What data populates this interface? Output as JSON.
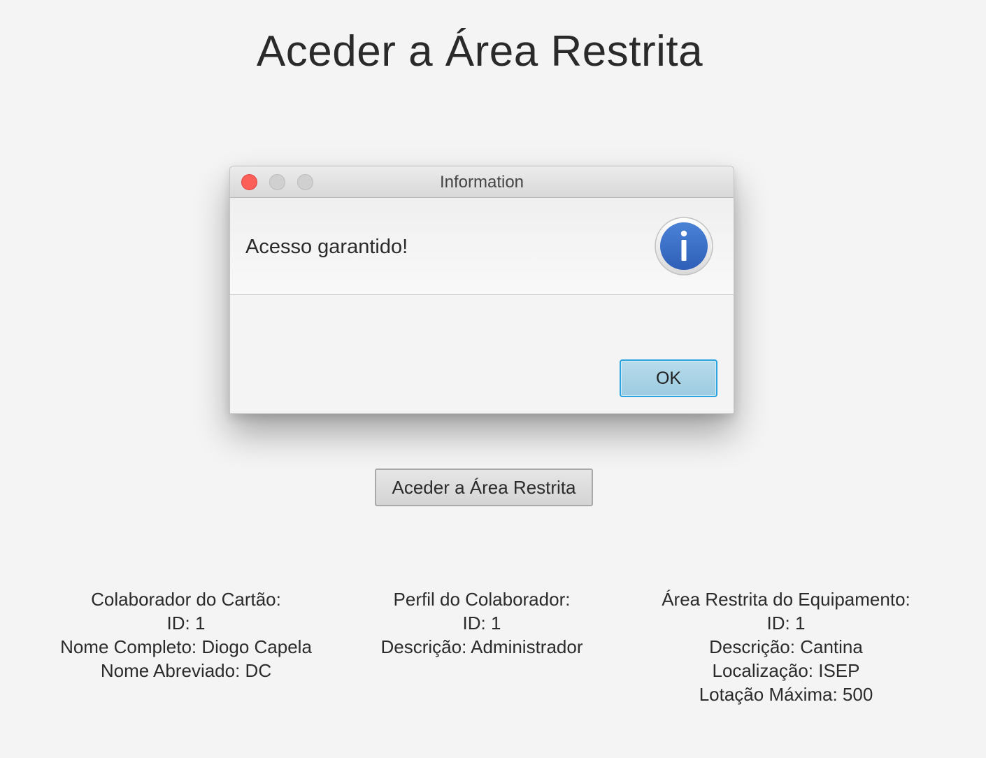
{
  "page": {
    "title": "Aceder a Área Restrita",
    "action_button": "Aceder a Área Restrita"
  },
  "dialog": {
    "title": "Information",
    "header_text": "Acesso garantido!",
    "icon": "info-icon",
    "ok_label": "OK"
  },
  "colaborador": {
    "heading": "Colaborador do Cartão:",
    "id": "ID: 1",
    "nome_completo": "Nome Completo: Diogo Capela",
    "nome_abreviado": "Nome Abreviado: DC"
  },
  "perfil": {
    "heading": "Perfil do Colaborador:",
    "id": "ID: 1",
    "descricao": "Descrição: Administrador"
  },
  "area": {
    "heading": "Área Restrita do Equipamento:",
    "id": "ID: 1",
    "descricao": "Descrição: Cantina",
    "localizacao": "Localização: ISEP",
    "lotacao": "Lotação Máxima: 500"
  },
  "colors": {
    "background": "#f4f4f4",
    "close_button": "#fc5f57",
    "ok_border": "#2ba3e0",
    "info_icon": "#3a6fc9"
  }
}
